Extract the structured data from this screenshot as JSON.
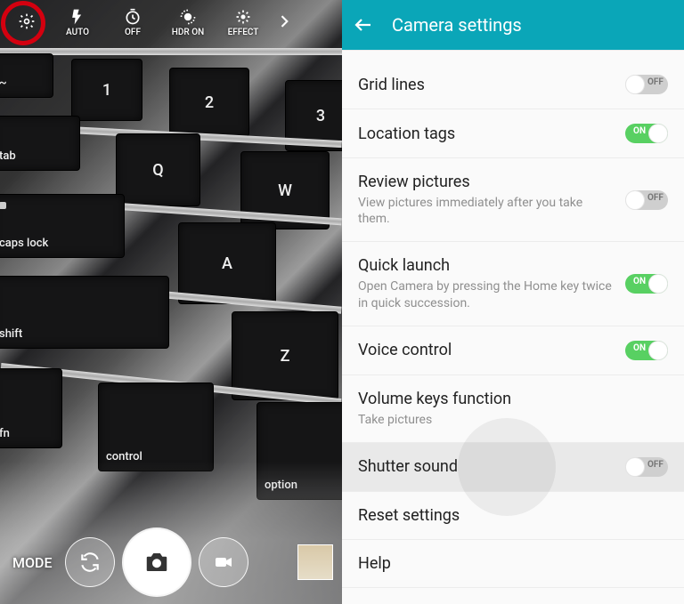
{
  "camera": {
    "topbar": {
      "settings": "",
      "flash_label": "AUTO",
      "timer_label": "OFF",
      "hdr_label": "HDR ON",
      "effect_label": "EFFECT"
    },
    "bottombar": {
      "mode_label": "MODE"
    }
  },
  "settings": {
    "title": "Camera settings",
    "items": [
      {
        "title": "Grid lines",
        "sub": "",
        "toggle": "off"
      },
      {
        "title": "Location tags",
        "sub": "",
        "toggle": "on"
      },
      {
        "title": "Review pictures",
        "sub": "View pictures immediately after you take them.",
        "toggle": "off"
      },
      {
        "title": "Quick launch",
        "sub": "Open Camera by pressing the Home key twice in quick succession.",
        "toggle": "on"
      },
      {
        "title": "Voice control",
        "sub": "",
        "toggle": "on"
      },
      {
        "title": "Volume keys function",
        "sub": "Take pictures",
        "toggle": null
      },
      {
        "title": "Shutter sound",
        "sub": "",
        "toggle": "off",
        "highlight": true
      },
      {
        "title": "Reset settings",
        "sub": "",
        "toggle": null
      },
      {
        "title": "Help",
        "sub": "",
        "toggle": null
      }
    ],
    "toggle_on_text": "ON",
    "toggle_off_text": "OFF"
  }
}
